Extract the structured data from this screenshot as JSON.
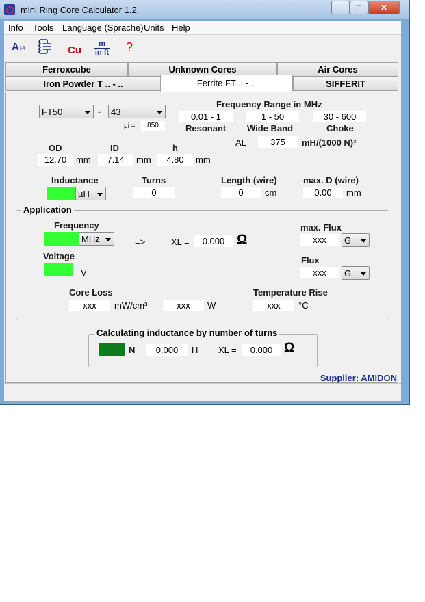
{
  "window": {
    "title": "mini Ring Core Calculator 1.2",
    "minimize": "─",
    "maximize": "□",
    "close": "✕"
  },
  "menu": [
    "Info",
    "Tools",
    "Language (Sprache)",
    "Units",
    "Help"
  ],
  "toolbar": {
    "calc_label": "A",
    "calc_sub": "μᵢ",
    "cu_label": "Cu",
    "unit_top": "m",
    "unit_bottom": "in ft",
    "help_label": "?"
  },
  "tabs": {
    "row1": [
      "Ferroxcube",
      "Unknown Cores",
      "Air Cores"
    ],
    "row2": [
      "Iron Powder T .. - ..",
      "Ferrite FT .. - ..",
      "SIFFERIT"
    ]
  },
  "core": {
    "type": "FT50",
    "material": "43",
    "dash": "-",
    "mu_label": "μi =",
    "mu_value": "850"
  },
  "freq_range": {
    "title": "Frequency Range in MHz",
    "resonant": "0.01 - 1",
    "resonant_label": "Resonant",
    "wideband": "1 - 50",
    "wideband_label": "Wide Band",
    "choke": "30 - 600",
    "choke_label": "Choke"
  },
  "al": {
    "label": "AL =",
    "value": "375",
    "unit": "mH/(1000 N)²"
  },
  "dims": {
    "od_label": "OD",
    "od": "12.70",
    "id_label": "ID",
    "id": "7.14",
    "h_label": "h",
    "h": "4.80",
    "unit": "mm"
  },
  "inductance": {
    "label": "Inductance",
    "unit": "µH"
  },
  "turns": {
    "label": "Turns",
    "value": "0"
  },
  "length": {
    "label": "Length (wire)",
    "value": "0",
    "unit": "cm"
  },
  "maxd": {
    "label": "max. D (wire)",
    "value": "0.00",
    "unit": "mm"
  },
  "application": {
    "title": "Application",
    "freq_label": "Frequency",
    "freq_unit": "MHz",
    "arrow": "=>",
    "xl_label": "XL =",
    "xl_value": "0.000",
    "ohm": "Ω",
    "voltage_label": "Voltage",
    "voltage_unit": "V",
    "maxflux_label": "max. Flux",
    "maxflux_value": "xxx",
    "maxflux_unit": "G",
    "flux_label": "Flux",
    "flux_value": "xxx",
    "flux_unit": "G",
    "coreloss_label": "Core Loss",
    "coreloss_value": "xxx",
    "coreloss_unit": "mW/cm³",
    "coreloss_w_value": "xxx",
    "coreloss_w_unit": "W",
    "temp_label": "Temperature Rise",
    "temp_value": "xxx",
    "temp_unit": "°C"
  },
  "by_turns": {
    "title": "Calculating inductance by number of turns",
    "n_unit": "N",
    "h_value": "0.000",
    "h_unit": "H",
    "xl_label": "XL =",
    "xl_value": "0.000",
    "ohm": "Ω"
  },
  "supplier": "Supplier: AMIDON",
  "colors": {
    "green": "#33ff33",
    "dark_green": "#0b7d1e",
    "supplier": "#1a2c8c",
    "help": "#d01010"
  }
}
